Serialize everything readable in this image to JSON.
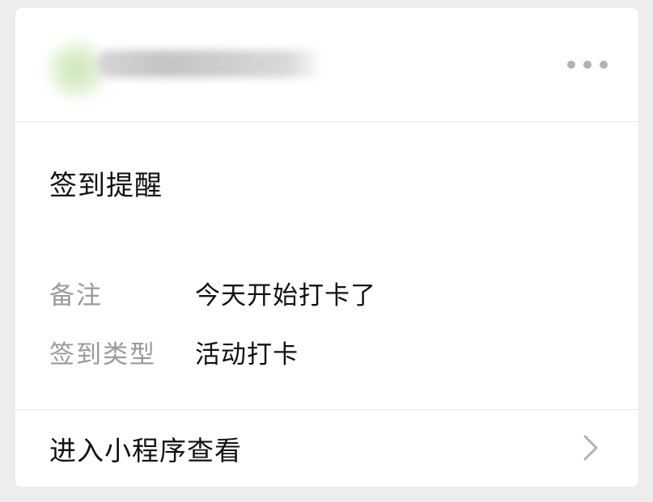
{
  "card": {
    "title": "签到提醒",
    "fields": [
      {
        "label": "备注",
        "value": "今天开始打卡了"
      },
      {
        "label": "签到类型",
        "value": "活动打卡"
      }
    ],
    "footer_link": "进入小程序查看"
  },
  "icons": {
    "more": "more-dots-icon",
    "chevron": "chevron-right-icon"
  },
  "colors": {
    "background": "#ededed",
    "card": "#ffffff",
    "label": "#9a9a9a",
    "text": "#111111",
    "divider": "#e5e5e5"
  }
}
